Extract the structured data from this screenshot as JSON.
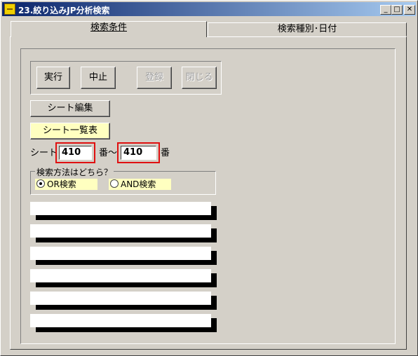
{
  "window": {
    "title": "23.絞り込みJP分析検索",
    "min_glyph": "_",
    "max_glyph": "□",
    "close_glyph": "✕"
  },
  "tabs": [
    {
      "label": "検索条件",
      "active": true
    },
    {
      "label": "検索種別･日付",
      "active": false
    }
  ],
  "toolbar": {
    "run_label": "実行",
    "stop_label": "中止",
    "register_label": "登録",
    "close_label": "閉じる"
  },
  "sheet": {
    "edit_label": "シート編集",
    "list_label": "シート一覧表",
    "range_prefix": "シート",
    "range_from_value": "410",
    "range_mid": "番〜",
    "range_to_value": "410",
    "range_suffix": "番"
  },
  "search_method": {
    "legend": "検索方法はどちら？",
    "options": [
      {
        "label": "OR検索",
        "selected": true
      },
      {
        "label": "AND検索",
        "selected": false
      }
    ]
  },
  "result_bars": 6
}
